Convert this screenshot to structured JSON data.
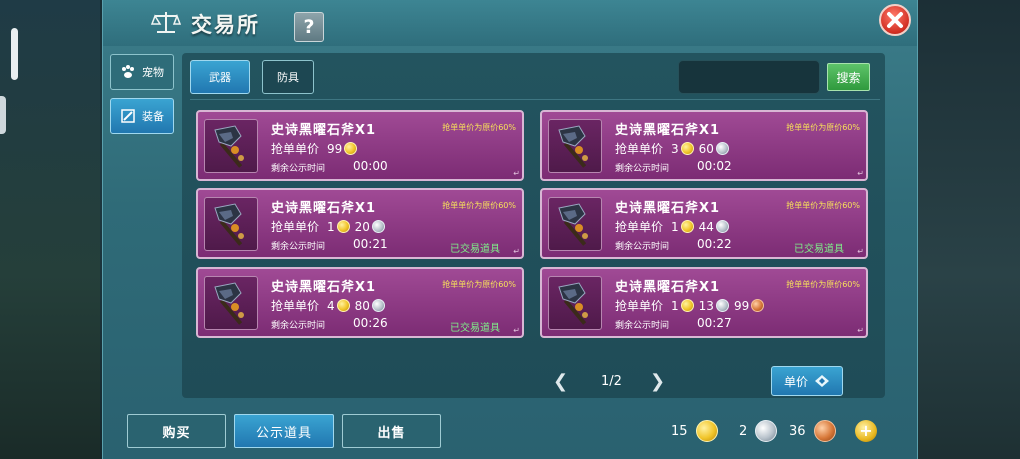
{
  "window": {
    "title": "交易所",
    "help_label": "?"
  },
  "categories": [
    {
      "label": "宠物",
      "icon": "paw-icon",
      "active": false
    },
    {
      "label": "装备",
      "icon": "equipment-icon",
      "active": true
    }
  ],
  "tabs": [
    {
      "label": "武器",
      "active": true
    },
    {
      "label": "防具",
      "active": false
    }
  ],
  "search": {
    "placeholder": "",
    "button_label": "搜索"
  },
  "listings": [
    {
      "name": "史诗黑曜石斧X1",
      "note": "抢单单价为原价60%",
      "price_label": "抢单单价",
      "price": [
        {
          "amount": "99",
          "coin": "gold"
        }
      ],
      "time_label": "剩余公示时间",
      "time": "00:00",
      "status": ""
    },
    {
      "name": "史诗黑曜石斧X1",
      "note": "抢单单价为原价60%",
      "price_label": "抢单单价",
      "price": [
        {
          "amount": "3",
          "coin": "gold"
        },
        {
          "amount": "60",
          "coin": "silver"
        }
      ],
      "time_label": "剩余公示时间",
      "time": "00:02",
      "status": ""
    },
    {
      "name": "史诗黑曜石斧X1",
      "note": "抢单单价为原价60%",
      "price_label": "抢单单价",
      "price": [
        {
          "amount": "1",
          "coin": "gold"
        },
        {
          "amount": "20",
          "coin": "silver"
        }
      ],
      "time_label": "剩余公示时间",
      "time": "00:21",
      "status": "已交易道具"
    },
    {
      "name": "史诗黑曜石斧X1",
      "note": "抢单单价为原价60%",
      "price_label": "抢单单价",
      "price": [
        {
          "amount": "1",
          "coin": "gold"
        },
        {
          "amount": "44",
          "coin": "silver"
        }
      ],
      "time_label": "剩余公示时间",
      "time": "00:22",
      "status": "已交易道具"
    },
    {
      "name": "史诗黑曜石斧X1",
      "note": "抢单单价为原价60%",
      "price_label": "抢单单价",
      "price": [
        {
          "amount": "4",
          "coin": "gold"
        },
        {
          "amount": "80",
          "coin": "silver"
        }
      ],
      "time_label": "剩余公示时间",
      "time": "00:26",
      "status": "已交易道具"
    },
    {
      "name": "史诗黑曜石斧X1",
      "note": "抢单单价为原价60%",
      "price_label": "抢单单价",
      "price": [
        {
          "amount": "1",
          "coin": "gold"
        },
        {
          "amount": "13",
          "coin": "silver"
        },
        {
          "amount": "99",
          "coin": "copper"
        }
      ],
      "time_label": "剩余公示时间",
      "time": "00:27",
      "status": ""
    }
  ],
  "pager": {
    "label": "1/2",
    "prev_icon": "chevron-left-icon",
    "next_icon": "chevron-right-icon"
  },
  "sort": {
    "label": "单价",
    "icon": "sort-diamond-icon"
  },
  "bottom": {
    "buy_label": "购买",
    "public_label": "公示道具",
    "sell_label": "出售",
    "active_tab": "公示道具"
  },
  "wallet": [
    {
      "amount": "15",
      "coin": "gold"
    },
    {
      "amount": "2",
      "coin": "silver"
    },
    {
      "amount": "36",
      "coin": "copper"
    }
  ],
  "add_label": "+",
  "colors": {
    "accent_blue": "#2a8cc4",
    "card_purple": "#8f3a86",
    "note_yellow": "#f7e05a",
    "traded_green": "#7ff08a",
    "search_green": "#3fae4c",
    "close_red": "#d12e22"
  }
}
